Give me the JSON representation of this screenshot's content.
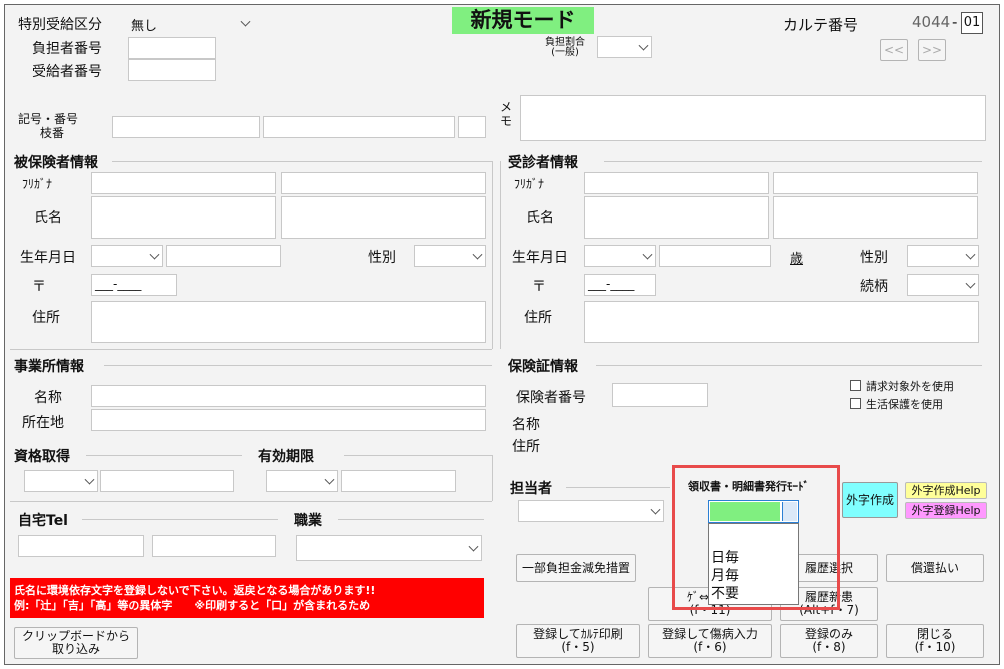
{
  "mode_label": "新規モード",
  "header": {
    "tokubetsu_label": "特別受給区分",
    "tokubetsu_value": "無し",
    "futansha_label": "負担者番号",
    "jukyusha_label": "受給者番号",
    "futan_wariai_label_1": "負担割合",
    "futan_wariai_label_2": "(一般)",
    "karte_label": "カルテ番号",
    "karte_number": "4044",
    "karte_dash": "-",
    "karte_branch": "01",
    "prev_label": "<<",
    "next_label": ">>"
  },
  "kigo": {
    "label_1": "記号・番号",
    "label_2": "枝番",
    "memo_1": "メ",
    "memo_2": "モ"
  },
  "hihokensha": {
    "title": "被保険者情報",
    "furigana": "ﾌﾘｶﾞﾅ",
    "name": "氏名",
    "birth": "生年月日",
    "sex": "性別",
    "zip_mark": "〒",
    "zip_value": "___-____",
    "address": "住所"
  },
  "jushinsha": {
    "title": "受診者情報",
    "furigana": "ﾌﾘｶﾞﾅ",
    "name": "氏名",
    "birth": "生年月日",
    "age": "歳",
    "sex": "性別",
    "zip_mark": "〒",
    "zip_value": "___-____",
    "zokugara": "続柄",
    "address": "住所"
  },
  "jigyosho": {
    "title": "事業所情報",
    "name": "名称",
    "address": "所在地"
  },
  "hokensho": {
    "title": "保険証情報",
    "number": "保険者番号",
    "name": "名称",
    "address": "住所",
    "check1": "請求対象外を使用",
    "check2": "生活保護を使用"
  },
  "shikaku": {
    "title": "資格取得"
  },
  "yuko": {
    "title": "有効期限"
  },
  "tanto": {
    "title": "担当者"
  },
  "jitaku": {
    "title": "自宅Tel"
  },
  "shokugyo": {
    "title": "職業"
  },
  "ryoshusho": {
    "title": "領収書・明細書発行ﾓｰﾄﾞ",
    "options": [
      "日毎",
      "月毎",
      "不要"
    ],
    "selected_color": "#80ef80"
  },
  "gaiji": {
    "create": "外字作成",
    "create_help": "外字作成Help",
    "register_help": "外字登録Help"
  },
  "warning": {
    "line1": "氏名に環境依存文字を登録しないで下さい。返戻となる場合があります!!",
    "line2": "例:「辻」「吉」「高」等の異体字　　※印刷すると「口」が含まれるため"
  },
  "buttons": {
    "clipboard_1": "クリップボードから",
    "clipboard_2": "取り込み",
    "ichibu": "一部負担金減免措置",
    "rireki_sentaku": "履歴選択",
    "shokan": "償還払い",
    "jusho_1": "ｹﾞ⇔住所",
    "jusho_2": "(f・11)",
    "rireki_shinki_1": "履歴新患",
    "rireki_shinki_2": "(Alt+f・7)",
    "karte_print_1": "登録してｶﾙﾃ印刷",
    "karte_print_2": "(f・5)",
    "shobyo_1": "登録して傷病入力",
    "shobyo_2": "(f・6)",
    "toroku_1": "登録のみ",
    "toroku_2": "(f・8)",
    "close_1": "閉じる",
    "close_2": "(f・10)"
  },
  "colors": {
    "mode_bg": "#80ef80",
    "warning_bg": "#ff0000",
    "highlight": "#e84a4a",
    "gaiji_create_bg": "#80ffff",
    "gaiji_create_help_bg": "#ffff99",
    "gaiji_register_help_bg": "#ff99ff"
  }
}
